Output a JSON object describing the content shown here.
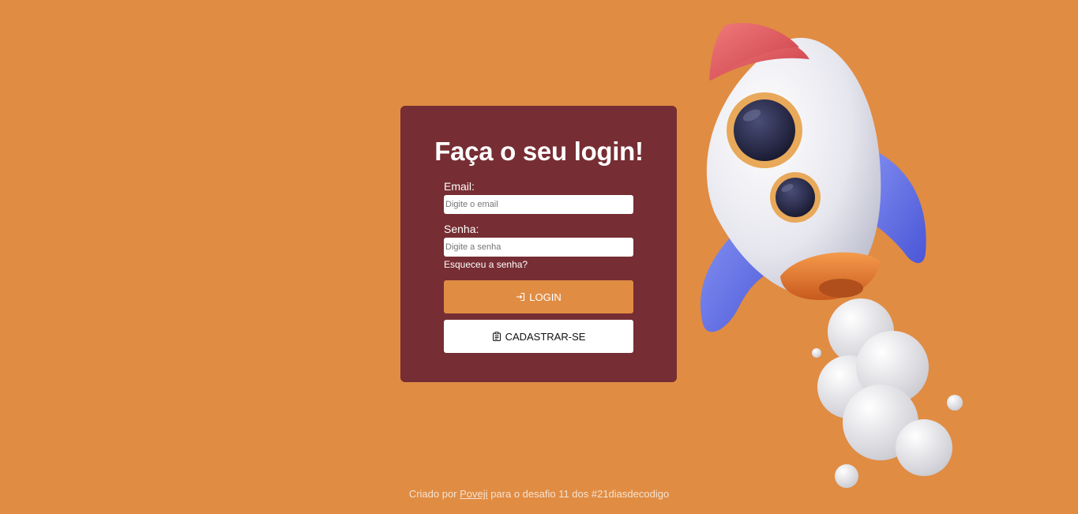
{
  "login": {
    "title": "Faça o seu login!",
    "email_label": "Email:",
    "email_placeholder": "Digite o email",
    "password_label": "Senha:",
    "password_placeholder": "Digite a senha",
    "forgot_link": "Esqueceu a senha?",
    "login_button": "LOGIN",
    "register_button": "CADASTRAR-SE"
  },
  "footer": {
    "prefix": "Criado por",
    "author_link": "Poveji",
    "suffix": "para o desafio 11 dos #21diasdecodigo"
  },
  "colors": {
    "background": "#E08C43",
    "card": "#762D33",
    "accent": "#E08C43"
  },
  "icons": {
    "login": "login-arrow-icon",
    "register": "clipboard-icon",
    "illustration": "rocket-illustration"
  }
}
